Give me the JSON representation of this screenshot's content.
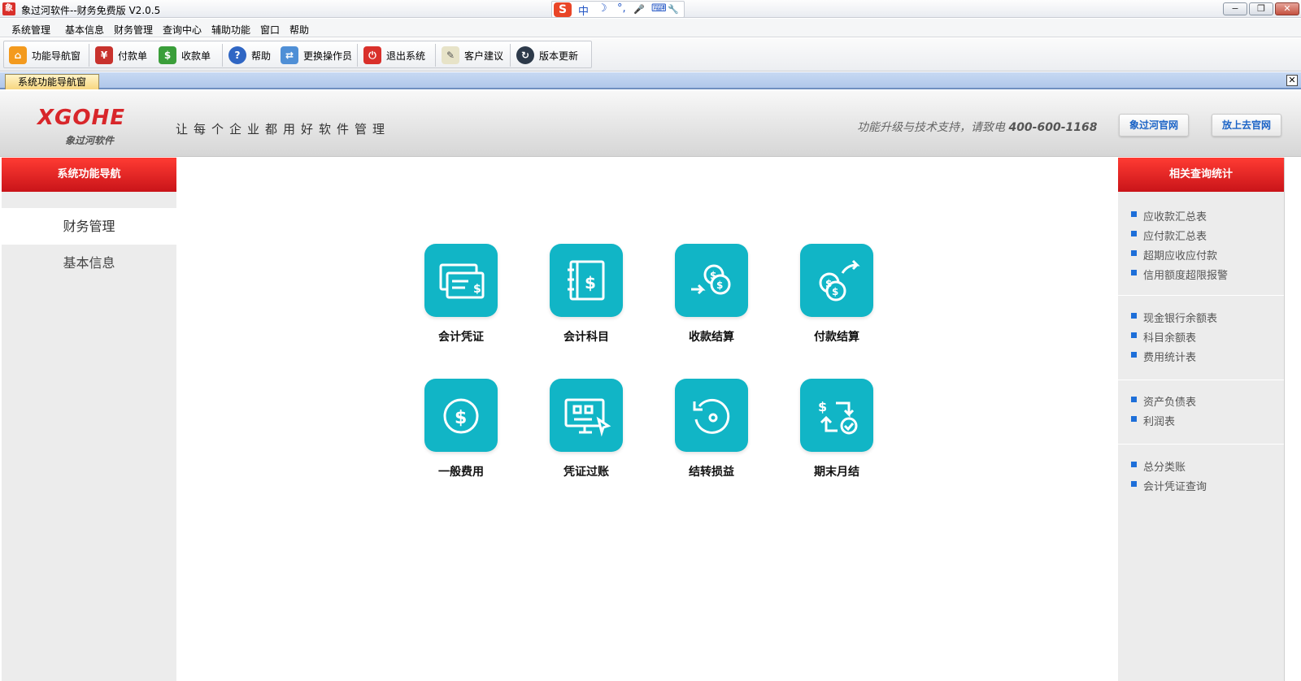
{
  "window": {
    "title": "象过河软件--财务免费版 V2.0.5",
    "app_icon": "app-logo-icon",
    "min_label": "−",
    "restore_label": "❐",
    "close_label": "✕"
  },
  "ime": {
    "logo": "S",
    "items": [
      "中",
      "☽",
      "°,",
      "🎤",
      "⌨",
      "🔧"
    ]
  },
  "menu": {
    "items": [
      "系统管理",
      "基本信息",
      "财务管理",
      "查询中心",
      "辅助功能",
      "窗口",
      "帮助"
    ]
  },
  "toolbar": {
    "buttons": [
      {
        "label": "功能导航窗",
        "icon": "home-icon"
      },
      {
        "label": "付款单",
        "icon": "payment-icon"
      },
      {
        "label": "收款单",
        "icon": "receipt-icon"
      },
      {
        "label": "帮助",
        "icon": "help-icon"
      },
      {
        "label": "更换操作员",
        "icon": "switch-user-icon"
      },
      {
        "label": "退出系统",
        "icon": "power-icon"
      },
      {
        "label": "客户建议",
        "icon": "edit-note-icon"
      },
      {
        "label": "版本更新",
        "icon": "update-icon"
      }
    ]
  },
  "tabs": {
    "active": "系统功能导航窗",
    "close_label": "✕"
  },
  "banner": {
    "logo": "XGOHE",
    "logo_sub": "象过河软件",
    "slogan": "让每个企业都用好软件管理",
    "support_text": "功能升级与技术支持，请致电",
    "phone": "400-600-1168",
    "btn_official": "象过河官网",
    "btn_cloud": "放上去官网"
  },
  "left_nav": {
    "title": "系统功能导航",
    "items": [
      {
        "label": "财务管理",
        "active": true
      },
      {
        "label": "基本信息",
        "active": false
      }
    ]
  },
  "tiles": [
    {
      "label": "会计凭证",
      "icon": "voucher-icon"
    },
    {
      "label": "会计科目",
      "icon": "account-book-icon"
    },
    {
      "label": "收款结算",
      "icon": "coin-receive-icon"
    },
    {
      "label": "付款结算",
      "icon": "coin-pay-icon"
    },
    {
      "label": "一般费用",
      "icon": "dollar-circle-icon"
    },
    {
      "label": "凭证过账",
      "icon": "monitor-post-icon"
    },
    {
      "label": "结转损益",
      "icon": "rotate-icon"
    },
    {
      "label": "期末月结",
      "icon": "period-close-icon"
    }
  ],
  "right_panel": {
    "title": "相关查询统计",
    "groups": [
      [
        "应收款汇总表",
        "应付款汇总表",
        "超期应收应付款",
        "信用额度超限报警"
      ],
      [
        "现金银行余额表",
        "科目余额表",
        "费用统计表"
      ],
      [
        "资产负债表",
        "利润表"
      ],
      [
        "总分类账",
        "会计凭证查询"
      ]
    ]
  },
  "colors": {
    "accent_red": "#d8262a",
    "tile_teal": "#11b5c6",
    "link_blue": "#1b63c6"
  }
}
